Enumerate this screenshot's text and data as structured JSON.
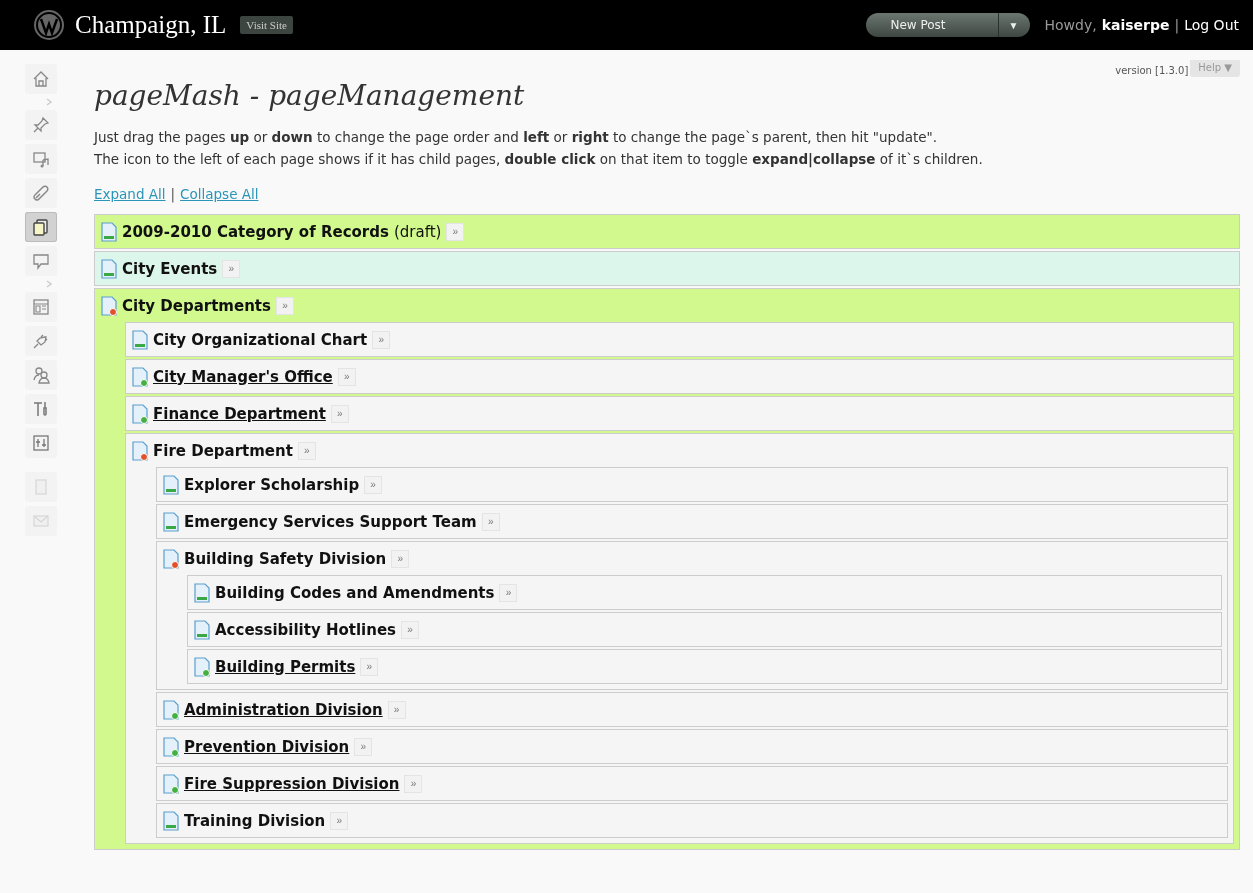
{
  "top_bar": {
    "site_title": "Champaign, IL",
    "visit_site": "Visit Site",
    "new_post": "New Post",
    "new_post_caret": "▼",
    "greeting": "Howdy,",
    "user": "kaiserpe",
    "separator": "|",
    "log_out": "Log Out"
  },
  "sidebar": {
    "items": [
      {
        "selected": false,
        "disabled": false
      },
      {
        "selected": false,
        "disabled": false
      },
      {
        "selected": false,
        "disabled": false
      },
      {
        "selected": false,
        "disabled": false
      },
      {
        "selected": true,
        "disabled": false
      },
      {
        "selected": false,
        "disabled": false
      },
      {
        "selected": false,
        "disabled": false
      },
      {
        "selected": false,
        "disabled": false
      },
      {
        "selected": false,
        "disabled": false
      },
      {
        "selected": false,
        "disabled": false
      },
      {
        "selected": false,
        "disabled": false
      },
      {
        "selected": false,
        "disabled": true
      },
      {
        "selected": false,
        "disabled": true
      }
    ]
  },
  "version": "version [1.3.0]",
  "help": "Help",
  "help_caret": "▼",
  "title": "pageMash - pageManagement",
  "instructions": [
    "Just drag the pages **up** or **down** to change the page order and **left** or **right** to change the page`s parent, then hit \"update\".",
    "The icon to the left of each page shows if it has child pages, **double click** on that item to toggle **expand|collapse** of it`s children."
  ],
  "expand_all": "Expand All",
  "collapse_all": "Collapse All",
  "links_separator": "|",
  "pages": [
    {
      "title": "2009-2010 Category of Records",
      "status": "(draft)",
      "kind": "leaf",
      "color": "#d1f98e"
    },
    {
      "title": "City Events",
      "kind": "leaf",
      "color": "#ddf6ec"
    },
    {
      "title": "City Departments",
      "kind": "expanded",
      "color": "#d1f98e",
      "children": [
        {
          "title": "City Organizational Chart",
          "kind": "leaf",
          "color": "#f4f5f4"
        },
        {
          "title": "City Manager's Office",
          "kind": "collapsed",
          "color": "#f4f5f4"
        },
        {
          "title": "Finance Department",
          "kind": "collapsed",
          "color": "#f4f5f4"
        },
        {
          "title": "Fire Department",
          "kind": "expanded",
          "color": "#f4f5f4",
          "children": [
            {
              "title": "Explorer Scholarship",
              "kind": "leaf",
              "color": "#f4f5f4"
            },
            {
              "title": "Emergency Services Support Team",
              "kind": "leaf",
              "color": "#f4f5f4"
            },
            {
              "title": "Building Safety Division",
              "kind": "expanded",
              "color": "#f4f5f4",
              "children": [
                {
                  "title": "Building Codes and Amendments",
                  "kind": "leaf",
                  "color": "#f4f5f4"
                },
                {
                  "title": "Accessibility Hotlines",
                  "kind": "leaf",
                  "color": "#f4f5f4"
                },
                {
                  "title": "Building Permits",
                  "kind": "collapsed",
                  "color": "#f4f5f4"
                }
              ]
            },
            {
              "title": "Administration Division",
              "kind": "collapsed",
              "color": "#f4f5f4"
            },
            {
              "title": "Prevention Division",
              "kind": "collapsed",
              "color": "#f4f5f4"
            },
            {
              "title": "Fire Suppression Division",
              "kind": "collapsed",
              "color": "#f4f5f4"
            },
            {
              "title": "Training Division",
              "kind": "leaf",
              "color": "#f4f5f4"
            }
          ]
        }
      ]
    }
  ],
  "more_button": "»"
}
